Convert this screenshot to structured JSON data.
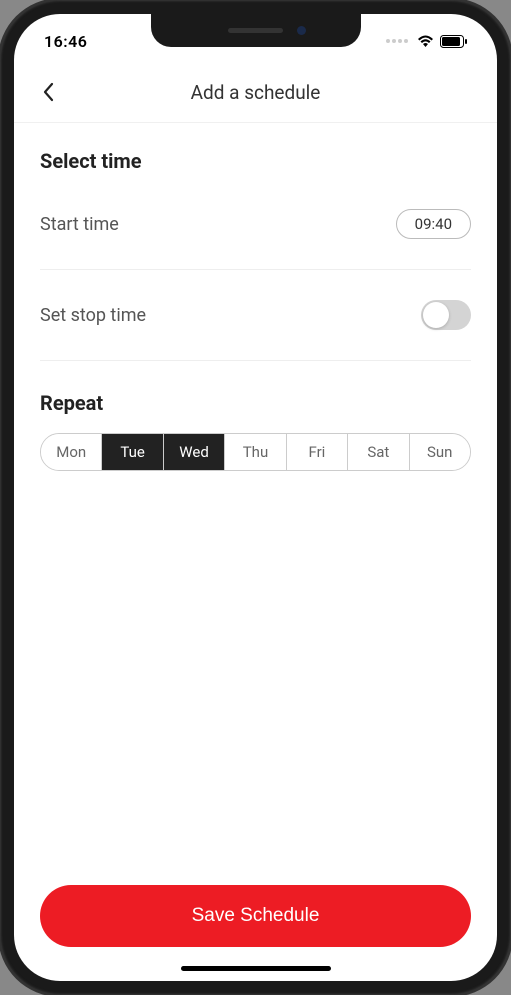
{
  "status": {
    "time": "16:46"
  },
  "header": {
    "title": "Add a schedule"
  },
  "select_time": {
    "heading": "Select time",
    "start_label": "Start time",
    "start_value": "09:40",
    "stop_label": "Set stop time",
    "stop_enabled": false
  },
  "repeat": {
    "heading": "Repeat",
    "days": [
      {
        "label": "Mon",
        "selected": false
      },
      {
        "label": "Tue",
        "selected": true
      },
      {
        "label": "Wed",
        "selected": true
      },
      {
        "label": "Thu",
        "selected": false
      },
      {
        "label": "Fri",
        "selected": false
      },
      {
        "label": "Sat",
        "selected": false
      },
      {
        "label": "Sun",
        "selected": false
      }
    ]
  },
  "footer": {
    "save_label": "Save Schedule"
  }
}
